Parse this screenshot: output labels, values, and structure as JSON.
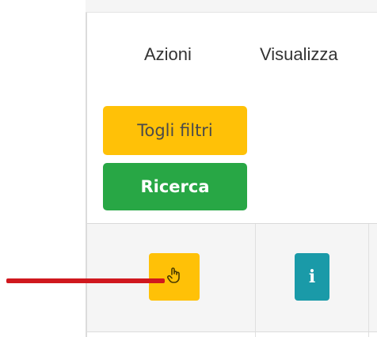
{
  "table": {
    "columns": {
      "actions": "Azioni",
      "view": "Visualizza"
    },
    "filter_buttons": {
      "clear": "Togli filtri",
      "search": "Ricerca"
    },
    "row": {
      "select_icon": "hand-pointer-icon",
      "info_icon": "info-icon",
      "info_glyph": "i"
    }
  },
  "annotation": {
    "arrow_color": "#d0181e"
  },
  "colors": {
    "warning": "#ffc107",
    "success": "#28a745",
    "info": "#1a9aa8"
  }
}
